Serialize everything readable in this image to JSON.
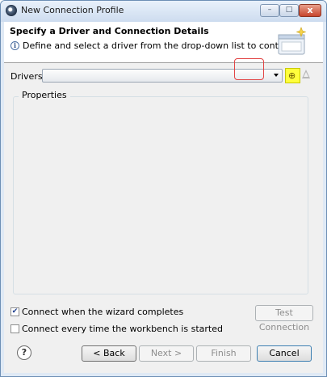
{
  "window": {
    "title": "New Connection Profile",
    "controls": {
      "minimize": "–",
      "maximize": "□",
      "close": "x"
    }
  },
  "header": {
    "title": "Specify a Driver and Connection Details",
    "info_glyph": "i",
    "message": "Define and select a driver from the drop-down list to continue."
  },
  "drivers": {
    "label": "Drivers:",
    "selected_value": "",
    "new_driver_glyph": "⊕"
  },
  "properties": {
    "label": "Properties"
  },
  "options": {
    "connect_on_complete": {
      "label": "Connect when the wizard completes",
      "checked": true,
      "mark": "✔"
    },
    "connect_on_startup": {
      "label": "Connect every time the workbench is started",
      "checked": false,
      "mark": ""
    }
  },
  "buttons": {
    "test_connection": "Test Connection",
    "back": "< Back",
    "next": "Next >",
    "finish": "Finish",
    "cancel": "Cancel",
    "help": "?"
  },
  "colors": {
    "highlight_yellow": "#ffff3c",
    "highlight_red": "#e24444"
  }
}
